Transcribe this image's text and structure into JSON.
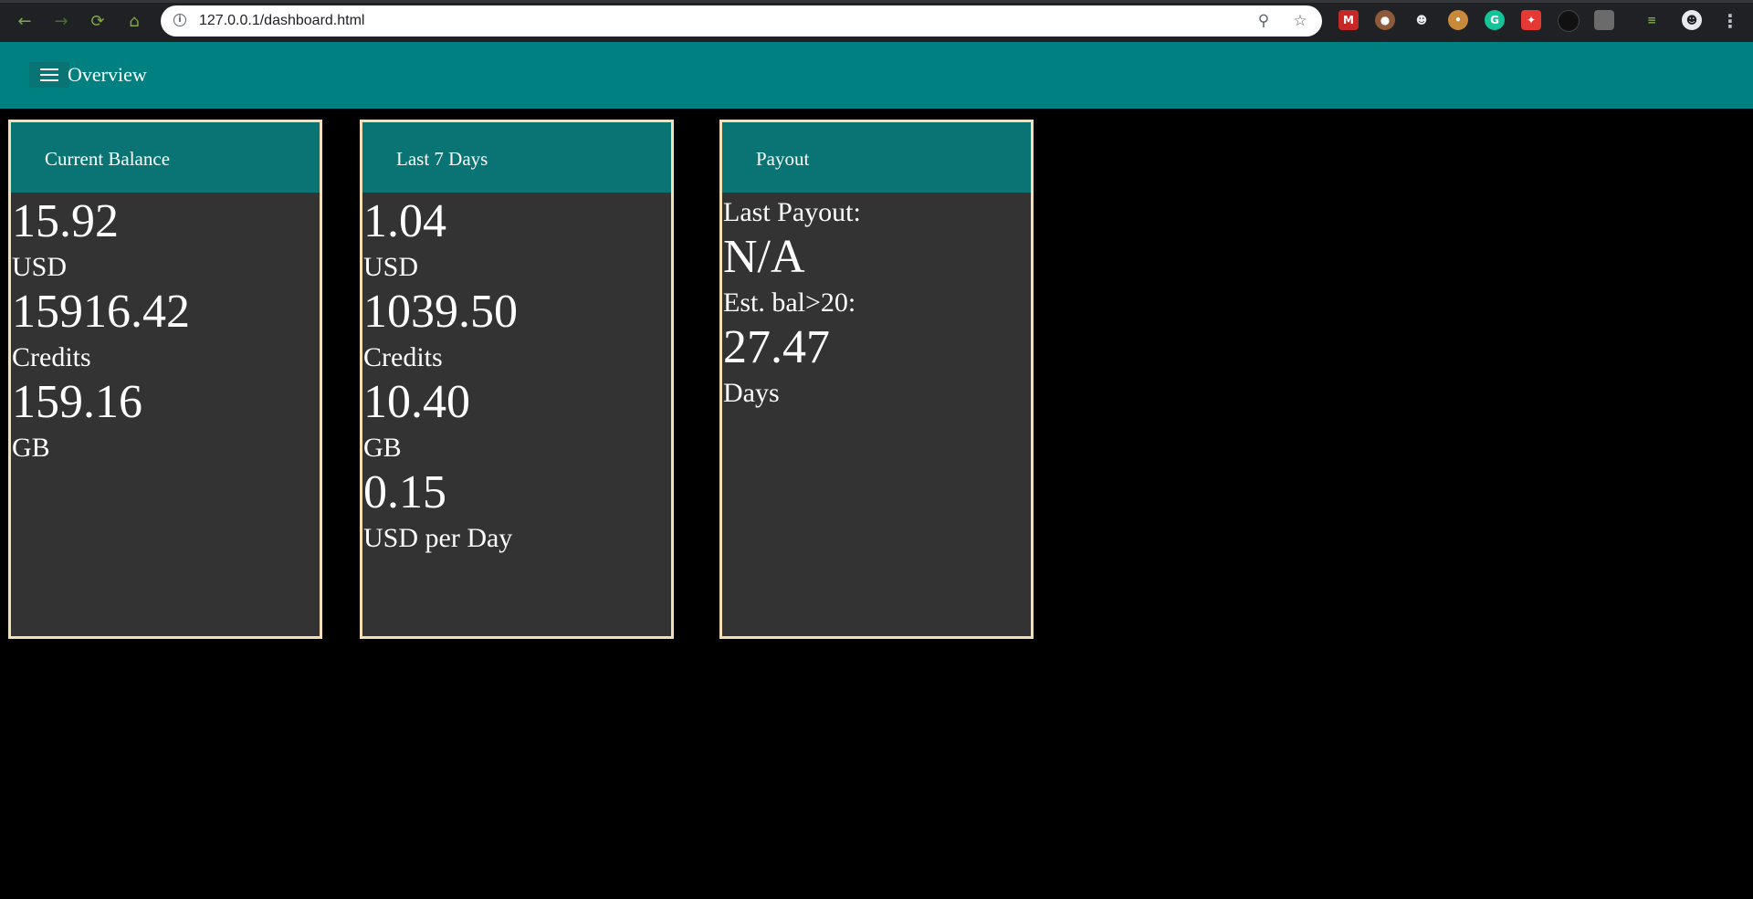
{
  "browser": {
    "url": "127.0.0.1/dashboard.html",
    "nav": {
      "back_icon": "back-arrow-icon",
      "forward_icon": "forward-arrow-icon",
      "reload_icon": "reload-icon",
      "home_icon": "home-icon"
    }
  },
  "appbar": {
    "title": "Overview",
    "color": "#008080"
  },
  "cards": [
    {
      "title": "Current Balance",
      "rows": [
        {
          "value": "15.92",
          "unit": "USD"
        },
        {
          "value": "15916.42",
          "unit": "Credits"
        },
        {
          "value": "159.16",
          "unit": "GB"
        }
      ]
    },
    {
      "title": "Last 7 Days",
      "rows": [
        {
          "value": "1.04",
          "unit": "USD"
        },
        {
          "value": "1039.50",
          "unit": "Credits"
        },
        {
          "value": "10.40",
          "unit": "GB"
        },
        {
          "value": "0.15",
          "unit": "USD per Day"
        }
      ]
    },
    {
      "title": "Payout",
      "last_payout_label": "Last Payout:",
      "last_payout_value": "N/A",
      "est_label": "Est. bal>20:",
      "est_value": "27.47",
      "est_unit": "Days"
    }
  ],
  "colors": {
    "card_header": "#0a7474",
    "card_body": "#333333",
    "card_border": "#f5deb3",
    "background": "#000000"
  }
}
